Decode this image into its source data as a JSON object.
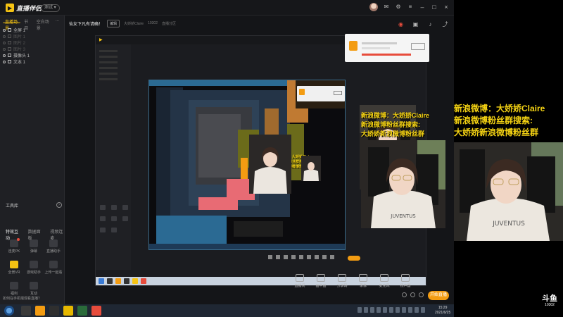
{
  "app": {
    "name": "直播伴侣",
    "version_label": "测试 ▾"
  },
  "scene": {
    "tabs": [
      "直播场景",
      "节目",
      "空白场景",
      "..."
    ],
    "sources": [
      {
        "label": "全屏 1",
        "dim": false
      },
      {
        "label": "图片 1",
        "dim": true
      },
      {
        "label": "图片 2",
        "dim": true
      },
      {
        "label": "图片 3",
        "dim": true
      },
      {
        "label": "摄像头 1",
        "dim": false
      },
      {
        "label": "文本 1",
        "dim": false
      }
    ]
  },
  "tools": {
    "header": "工具库",
    "tabs": [
      "特效互动",
      "数据面板",
      "视频连麦"
    ],
    "items": [
      {
        "label": "连麦PK",
        "style": "red"
      },
      {
        "label": "弹幕",
        "style": ""
      },
      {
        "label": "直播助手",
        "style": ""
      },
      {
        "label": "全景VR",
        "style": "ylw"
      },
      {
        "label": "游戏助手",
        "style": ""
      },
      {
        "label": "上传一起看",
        "style": ""
      },
      {
        "label": "福利",
        "style": ""
      },
      {
        "label": "互动",
        "style": ""
      }
    ]
  },
  "center": {
    "title": "仙女下凡有请确！",
    "tag": "编辑",
    "meta_1": "大娇娇Claire",
    "meta_2": "10302",
    "meta_3": "直播分区"
  },
  "controls": [
    "直播间",
    "画中画",
    "分享码",
    "录像",
    "麦克风",
    "扬声器"
  ],
  "go_live_label": "开始直播",
  "overlay_lines": [
    "新浪微博：大娇娇Claire",
    "新浪微博粉丝群搜索:",
    "大娇娇新浪微博粉丝群"
  ],
  "brand": {
    "mark": "斗鱼",
    "id": "10302"
  },
  "taskbar": {
    "clock_time": "15:29",
    "clock_date": "2021/6/25"
  },
  "hint": "如何在手机端观看直播？",
  "colors": {
    "accent": "#f5c313",
    "overlay_text": "#f5d313",
    "go_live": "#f39c12"
  }
}
